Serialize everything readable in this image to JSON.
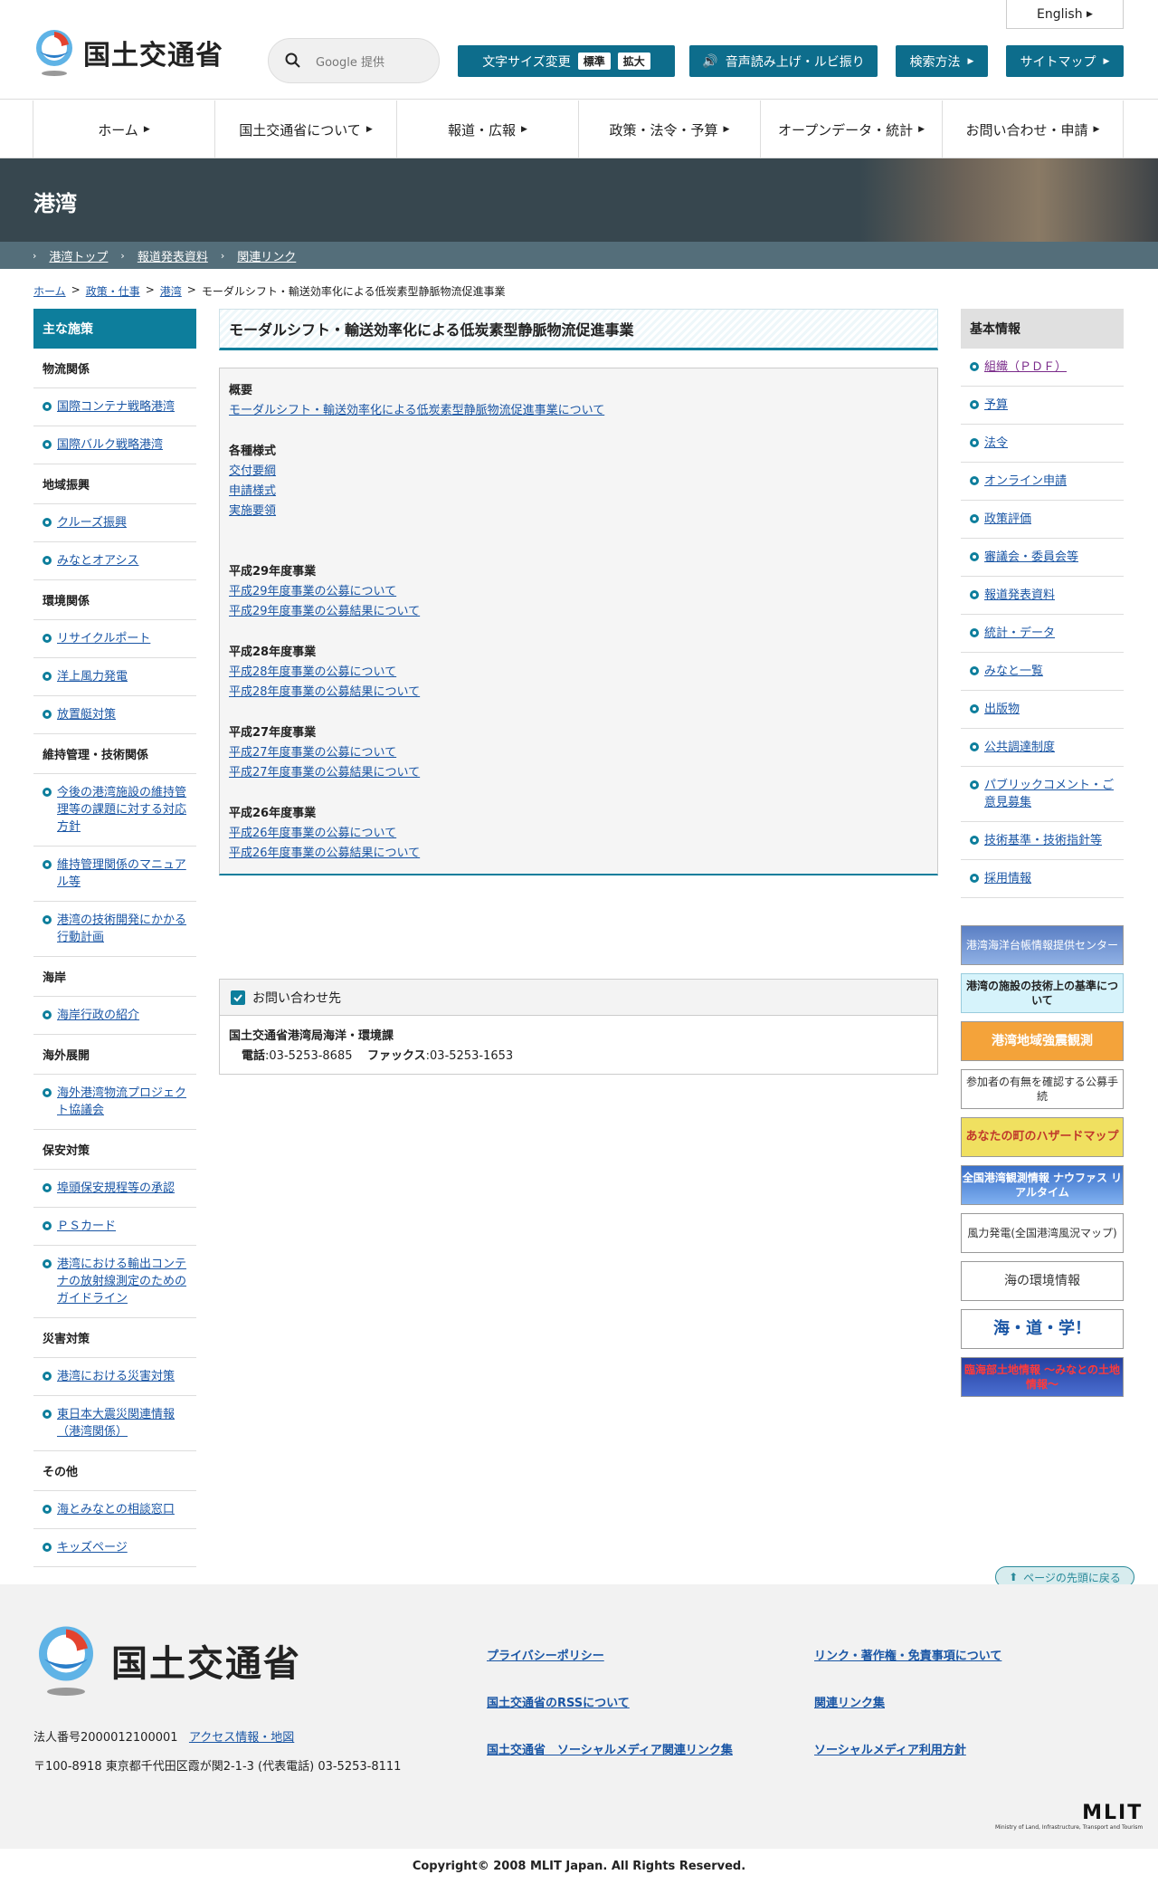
{
  "header": {
    "logo_text": "国土交通省",
    "search_placeholder": "Google 提供",
    "english": "English",
    "font_size_label": "文字サイズ変更",
    "font_size_standard": "標準",
    "font_size_large": "拡大",
    "audio_label": "音声読み上げ・ルビ振り",
    "search_method": "検索方法",
    "sitemap": "サイトマップ"
  },
  "gnav": [
    "ホーム",
    "国土交通省について",
    "報道・広報",
    "政策・法令・予算",
    "オープンデータ・統計",
    "お問い合わせ・申請"
  ],
  "banner": {
    "title": "港湾"
  },
  "subnav": [
    "港湾トップ",
    "報道発表資料",
    "関連リンク"
  ],
  "breadcrumb": [
    "ホーム",
    "政策・仕事",
    "港湾",
    "モーダルシフト・輸送効率化による低炭素型静脈物流促進事業"
  ],
  "left_nav": {
    "heading": "主な施策",
    "sections": [
      {
        "title": "物流関係",
        "items": [
          "国際コンテナ戦略港湾",
          "国際バルク戦略港湾"
        ]
      },
      {
        "title": "地域振興",
        "items": [
          "クルーズ振興",
          "みなとオアシス"
        ]
      },
      {
        "title": "環境関係",
        "items": [
          "リサイクルポート",
          "洋上風力発電",
          "放置艇対策"
        ]
      },
      {
        "title": "維持管理・技術関係",
        "items": [
          "今後の港湾施設の維持管理等の課題に対する対応方針",
          "維持管理関係のマニュアル等",
          "港湾の技術開発にかかる行動計画"
        ]
      },
      {
        "title": "海岸",
        "items": [
          "海岸行政の紹介"
        ]
      },
      {
        "title": "海外展開",
        "items": [
          "海外港湾物流プロジェクト協議会"
        ]
      },
      {
        "title": "保安対策",
        "items": [
          "埠頭保安規程等の承認",
          "ＰＳカード",
          "港湾における輸出コンテナの放射線測定のためのガイドライン"
        ]
      },
      {
        "title": "災害対策",
        "items": [
          "港湾における災害対策",
          "東日本大震災関連情報（港湾関係）"
        ]
      },
      {
        "title": "その他",
        "items": [
          "海とみなとの相談窓口",
          "キッズページ"
        ]
      }
    ]
  },
  "main": {
    "title": "モーダルシフト・輸送効率化による低炭素型静脈物流促進事業",
    "sections": [
      {
        "heading": "概要",
        "links": [
          "モーダルシフト・輸送効率化による低炭素型静脈物流促進事業について"
        ]
      },
      {
        "heading": "各種様式",
        "links": [
          "交付要綱",
          "申請様式",
          "実施要領"
        ]
      },
      {
        "heading": "平成29年度事業",
        "links": [
          "平成29年度事業の公募について",
          "平成29年度事業の公募結果について"
        ]
      },
      {
        "heading": "平成28年度事業",
        "links": [
          "平成28年度事業の公募について",
          "平成28年度事業の公募結果について"
        ]
      },
      {
        "heading": "平成27年度事業",
        "links": [
          "平成27年度事業の公募について",
          "平成27年度事業の公募結果について"
        ]
      },
      {
        "heading": "平成26年度事業",
        "links": [
          "平成26年度事業の公募について",
          "平成26年度事業の公募結果について"
        ]
      }
    ],
    "contact": {
      "heading": "お問い合わせ先",
      "org": "国土交通省港湾局海洋・環境課",
      "tel_label": "電話",
      "tel": ":03-5253-8685",
      "fax_label": "ファックス",
      "fax": ":03-5253-1653"
    }
  },
  "right_nav": {
    "heading": "基本情報",
    "items": [
      "組織（ＰＤＦ）",
      "予算",
      "法令",
      "オンライン申請",
      "政策評価",
      "審議会・委員会等",
      "報道発表資料",
      "統計・データ",
      "みなと一覧",
      "出版物",
      "公共調達制度",
      "パブリックコメント・ご意見募集",
      "技術基準・技術指針等",
      "採用情報"
    ],
    "banners": [
      "港湾海洋台帳情報提供センター",
      "港湾の施設の技術上の基準について",
      "港湾地域強震観測",
      "参加者の有無を確認する公募手続",
      "あなたの町のハザードマップ",
      "全国港湾観測情報 ナウファス リアルタイム",
      "風力発電(全国港湾風況マップ)",
      "海の環境情報",
      "海・道・学！",
      "臨海部土地情報 〜みなとの土地情報〜"
    ]
  },
  "footer": {
    "pagetop": "ページの先頭に戻る",
    "logo_text": "国土交通省",
    "corp_number": "法人番号2000012100001",
    "access": "アクセス情報・地図",
    "address": "〒100-8918 東京都千代田区霞が関2-1-3 (代表電話) 03-5253-8111",
    "links": [
      "プライバシーポリシー",
      "リンク・著作権・免責事項について",
      "国土交通省のRSSについて",
      "関連リンク集",
      "国土交通省　ソーシャルメディア関連リンク集",
      "ソーシャルメディア利用方針"
    ],
    "mlit": "MLIT",
    "mlit_sub": "Ministry of Land, Infrastructure, Transport and Tourism",
    "copyright": "Copyright© 2008 MLIT Japan. All Rights Reserved."
  },
  "colors": {
    "accent": "#0d7e9c",
    "link": "#1a56a5",
    "banner": "#37474f"
  }
}
